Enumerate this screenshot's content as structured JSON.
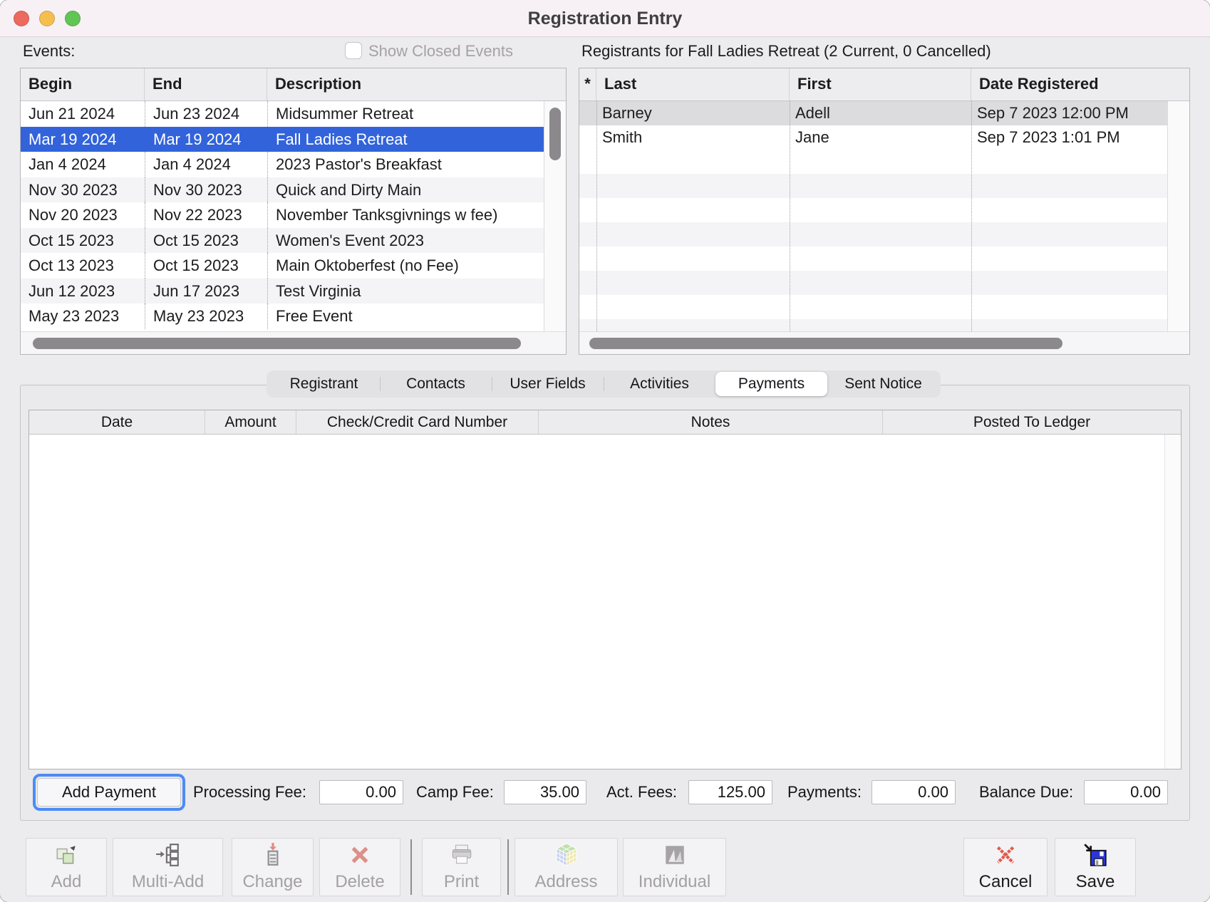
{
  "window": {
    "title": "Registration Entry"
  },
  "events": {
    "label": "Events:",
    "show_closed_label": "Show Closed Events",
    "show_closed_checked": false,
    "columns": [
      "Begin",
      "End",
      "Description"
    ],
    "selected_index": 1,
    "rows": [
      {
        "begin": "Jun 21 2024",
        "end": "Jun 23 2024",
        "description": "Midsummer Retreat"
      },
      {
        "begin": "Mar 19 2024",
        "end": "Mar 19 2024",
        "description": "Fall Ladies Retreat"
      },
      {
        "begin": "Jan 4 2024",
        "end": "Jan 4 2024",
        "description": "2023 Pastor's Breakfast"
      },
      {
        "begin": "Nov 30 2023",
        "end": "Nov 30 2023",
        "description": "Quick and Dirty Main"
      },
      {
        "begin": "Nov 20 2023",
        "end": "Nov 22 2023",
        "description": "November Tanksgivnings w fee)"
      },
      {
        "begin": "Oct 15 2023",
        "end": "Oct 15 2023",
        "description": "Women's Event 2023"
      },
      {
        "begin": "Oct 13 2023",
        "end": "Oct 15 2023",
        "description": "Main Oktoberfest (no Fee)"
      },
      {
        "begin": "Jun 12 2023",
        "end": "Jun 17 2023",
        "description": "Test Virginia"
      },
      {
        "begin": "May 23 2023",
        "end": "May 23 2023",
        "description": "Free Event"
      }
    ]
  },
  "registrants": {
    "title": "Registrants for Fall Ladies Retreat (2 Current, 0 Cancelled)",
    "columns": [
      "*",
      "Last",
      "First",
      "Date Registered"
    ],
    "selected_index": 0,
    "rows": [
      {
        "last": "Barney",
        "first": "Adell",
        "date_registered": "Sep 7 2023 12:00 PM"
      },
      {
        "last": "Smith",
        "first": "Jane",
        "date_registered": "Sep 7 2023 1:01 PM"
      }
    ]
  },
  "tabs": {
    "items": [
      "Registrant",
      "Contacts",
      "User Fields",
      "Activities",
      "Payments",
      "Sent Notice"
    ],
    "selected": "Payments"
  },
  "payments_table": {
    "columns": [
      "Date",
      "Amount",
      "Check/Credit Card Number",
      "Notes",
      "Posted To Ledger"
    ],
    "rows": []
  },
  "payment_summary": {
    "add_payment_label": "Add Payment",
    "fields": [
      {
        "label": "Processing Fee:",
        "value": "0.00"
      },
      {
        "label": "Camp Fee:",
        "value": "35.00"
      },
      {
        "label": "Act. Fees:",
        "value": "125.00"
      },
      {
        "label": "Payments:",
        "value": "0.00"
      },
      {
        "label": "Balance Due:",
        "value": "0.00"
      }
    ]
  },
  "toolbar": {
    "items": [
      {
        "type": "button",
        "label": "Add",
        "icon": "add-icon",
        "enabled": false
      },
      {
        "type": "button",
        "label": "Multi-Add",
        "icon": "multi-add-icon",
        "enabled": false
      },
      {
        "type": "button",
        "label": "Change",
        "icon": "change-icon",
        "enabled": false
      },
      {
        "type": "button",
        "label": "Delete",
        "icon": "delete-icon",
        "enabled": false
      },
      {
        "type": "separator"
      },
      {
        "type": "button",
        "label": "Print",
        "icon": "print-icon",
        "enabled": false
      },
      {
        "type": "separator"
      },
      {
        "type": "button",
        "label": "Address",
        "icon": "address-icon",
        "enabled": false
      },
      {
        "type": "button",
        "label": "Individual",
        "icon": "individual-icon",
        "enabled": false
      }
    ],
    "right_items": [
      {
        "type": "button",
        "label": "Cancel",
        "icon": "cancel-icon",
        "enabled": true
      },
      {
        "type": "button",
        "label": "Save",
        "icon": "save-icon",
        "enabled": true
      }
    ]
  },
  "colors": {
    "selection_blue": "#3263da",
    "selected_row_gray": "#dcdbdd",
    "focus_ring_blue": "#4c8bf5",
    "traffic_red": "#ed6a5e",
    "traffic_yellow": "#f4bf4f",
    "traffic_green": "#61c554",
    "disabled_text": "#a3a0a3",
    "delete_icon_red": "#db9089",
    "cancel_icon_red": "#e2594b",
    "save_icon_blue": "#2b36d9"
  }
}
